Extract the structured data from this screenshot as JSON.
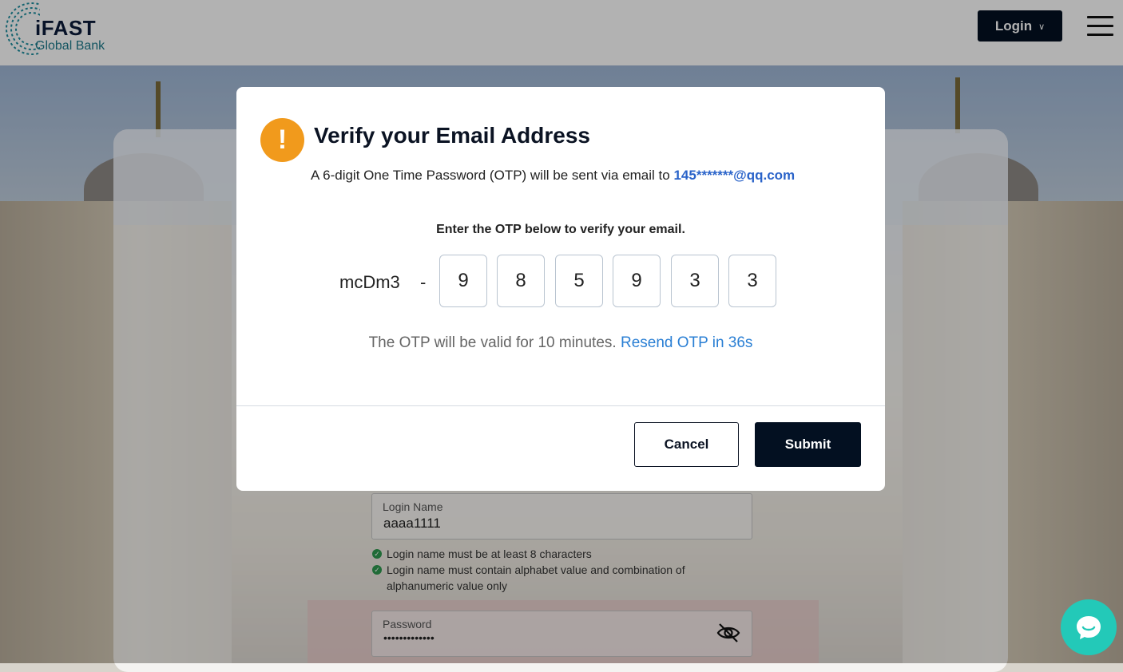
{
  "header": {
    "logo_brand": "iFAST",
    "logo_sub": "Global Bank",
    "login_label": "Login"
  },
  "form": {
    "login_name_label": "Login Name",
    "login_name_value": "aaaa1111",
    "hints": [
      "Login name must be at least 8 characters",
      "Login name must contain alphabet value and combination of alphanumeric value only"
    ],
    "password_label": "Password",
    "password_value": "•••••••••••••"
  },
  "modal": {
    "title": "Verify your Email Address",
    "sent_text": "A 6-digit One Time Password (OTP) will be sent via email to",
    "email": "145*******@qq.com",
    "enter_text": "Enter the OTP below to verify your email.",
    "prefix": "mcDm3",
    "dash": "-",
    "otp_digits": [
      "9",
      "8",
      "5",
      "9",
      "3",
      "3"
    ],
    "valid_text": "The OTP will be valid for 10 minutes.",
    "resend_text": "Resend OTP in 36s",
    "cancel_label": "Cancel",
    "submit_label": "Submit"
  },
  "colors": {
    "primary_dark": "#031021",
    "warning": "#f19a1c",
    "link": "#2a7fd4",
    "chat": "#23c9b8"
  }
}
